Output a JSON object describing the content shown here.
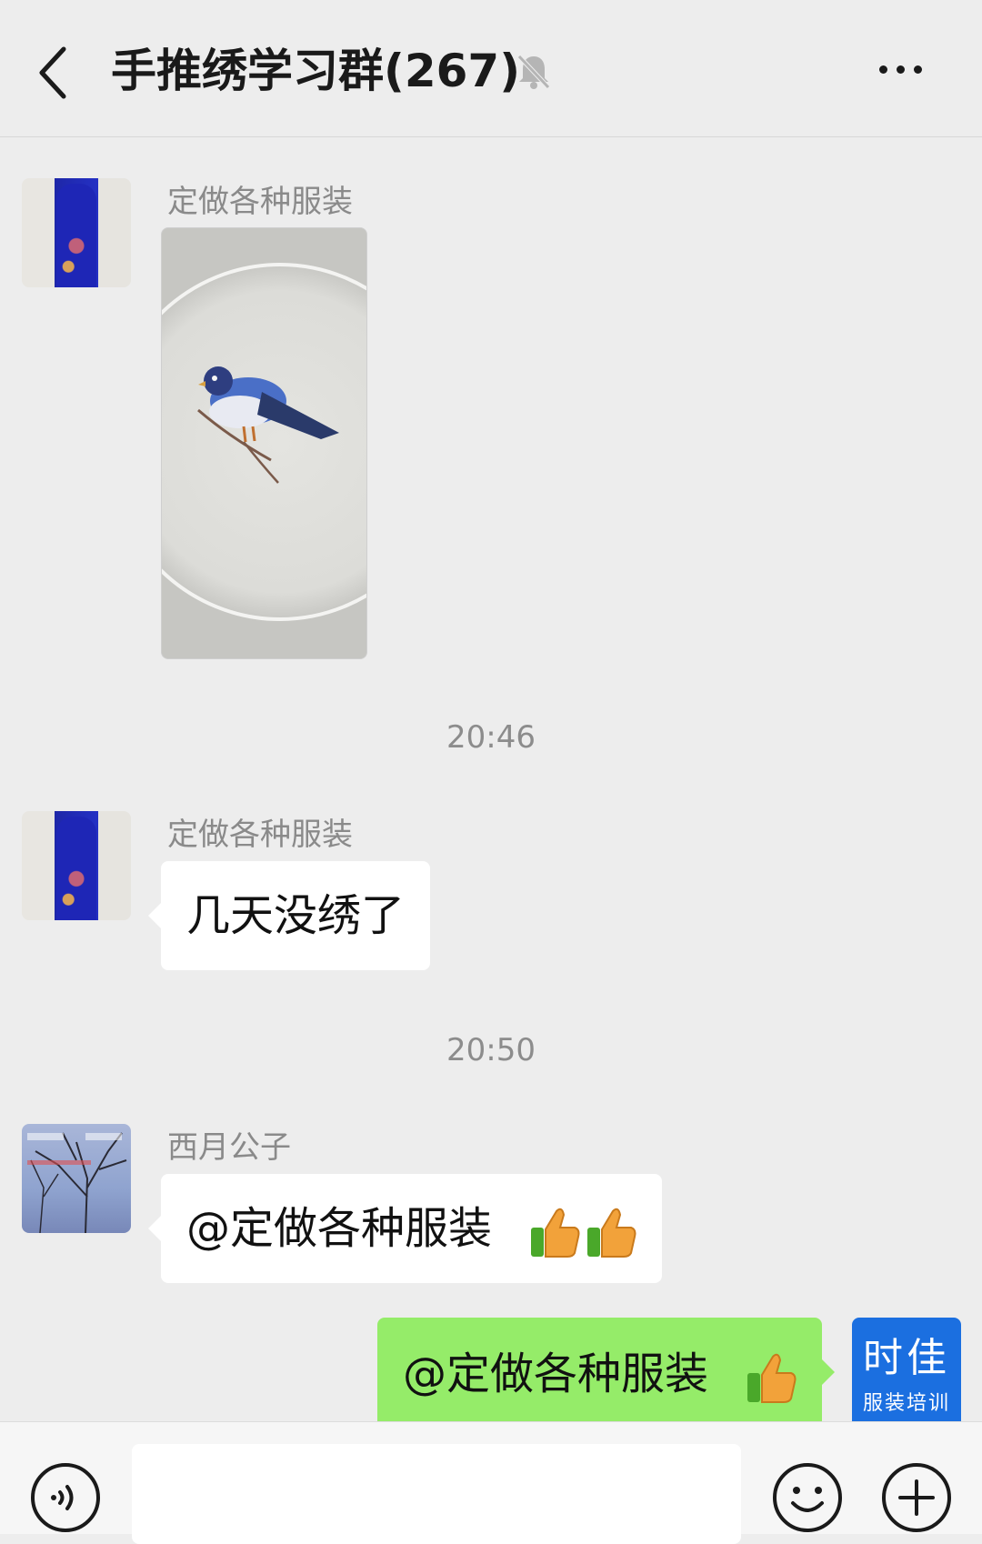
{
  "header": {
    "title": "手推绣学习群(267)",
    "back_icon": "chevron-left-icon",
    "mute_icon": "bell-muted-icon",
    "more_icon": "more-dots-icon"
  },
  "messages": [
    {
      "type": "image",
      "sender": "定做各种服装",
      "avatar": "qipao-photo"
    },
    {
      "type": "time",
      "text": "20:46"
    },
    {
      "type": "text",
      "sender": "定做各种服装",
      "avatar": "qipao-photo",
      "text": "几天没绣了"
    },
    {
      "type": "time",
      "text": "20:50"
    },
    {
      "type": "text",
      "sender": "西月公子",
      "avatar": "tree-photo",
      "text": "@定做各种服装"
    },
    {
      "type": "text",
      "outgoing": true,
      "text": "@定做各种服装"
    }
  ],
  "avatars": {
    "brand": {
      "line1": "时佳",
      "line2": "服装培训"
    }
  },
  "input_bar": {
    "voice_icon": "voice-icon",
    "emoji_icon": "emoji-icon",
    "plus_icon": "plus-icon",
    "input_value": ""
  },
  "colors": {
    "background": "#ededed",
    "incoming_bubble": "#ffffff",
    "outgoing_bubble": "#95ec69",
    "brand_avatar": "#1b6fe0"
  }
}
